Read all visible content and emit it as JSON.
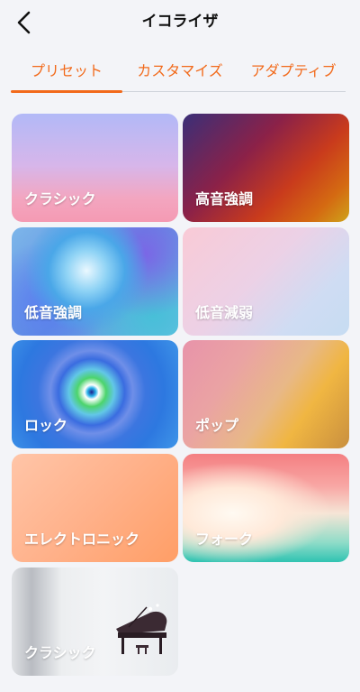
{
  "header": {
    "title": "イコライザ"
  },
  "tabs": [
    {
      "label": "プリセット"
    },
    {
      "label": "カスタマイズ"
    },
    {
      "label": "アダプティブ"
    }
  ],
  "presets": [
    {
      "label": "クラシック"
    },
    {
      "label": "高音強調"
    },
    {
      "label": "低音強調"
    },
    {
      "label": "低音減弱"
    },
    {
      "label": "ロック"
    },
    {
      "label": "ポップ"
    },
    {
      "label": "エレクトロニック"
    },
    {
      "label": "フォーク"
    },
    {
      "label": "クラシック"
    }
  ],
  "icons": {
    "back": "back-arrow-icon",
    "piano": "grand-piano-image"
  },
  "colors": {
    "accent": "#f26a1b",
    "background": "#f3f4f8",
    "title": "#111111",
    "card_label": "#ffffff"
  }
}
